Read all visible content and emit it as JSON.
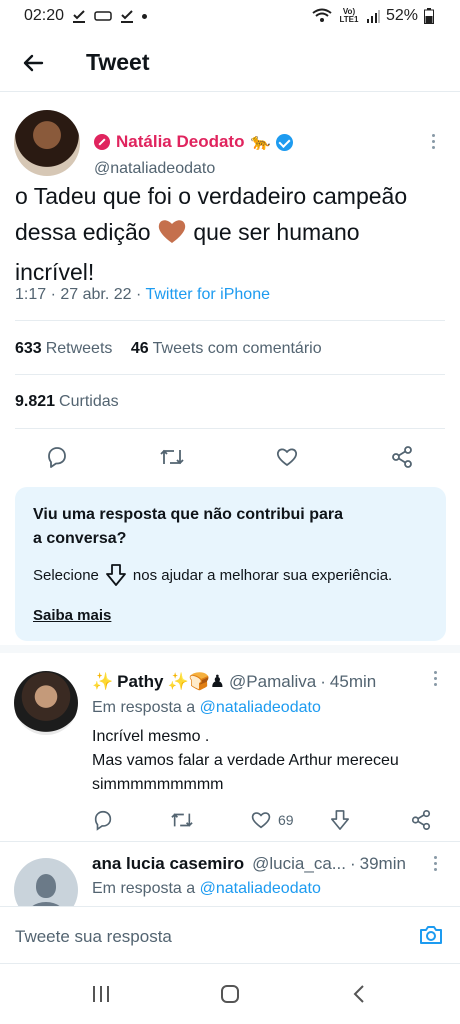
{
  "status_bar": {
    "time": "02:20",
    "network": "Vo) LTE1",
    "battery": "52%"
  },
  "header": {
    "title": "Tweet"
  },
  "tweet": {
    "author_name": "Natália Deodato",
    "author_emoji": "🐆",
    "author_handle": "@nataliadeodato",
    "text_part1": "o Tadeu que foi o verdadeiro campeão dessa edição",
    "text_emoji": "🤎",
    "text_part2": "que ser humano incrível!",
    "time": "1:17",
    "date": "27 abr. 22",
    "separator": "·",
    "source": "Twitter for iPhone",
    "retweets_count": "633",
    "retweets_label": "Retweets",
    "comments_count": "46",
    "comments_label": "Tweets com comentário",
    "likes_count": "9.821",
    "likes_label": "Curtidas"
  },
  "notice": {
    "title": "Viu uma resposta que não contribui para a conversa?",
    "body_prefix": "Selecione",
    "body_suffix": "nos ajudar a melhorar sua experiência.",
    "link": "Saiba mais"
  },
  "replies": [
    {
      "name_prefix_emoji": "✨",
      "name": "Pathy",
      "name_suffix_emoji": "✨🍞♟",
      "handle": "@Pamaliva",
      "time": "45min",
      "reply_to_label": "Em resposta a",
      "reply_to": "@nataliadeodato",
      "text_line1": "Incrível mesmo .",
      "text_line2": "Mas vamos falar a verdade Arthur mereceu simmmmmmmmm",
      "likes": "69"
    },
    {
      "name": "ana lucia casemiro",
      "handle": "@lucia_ca...",
      "time": "39min",
      "reply_to_label": "Em resposta a",
      "reply_to": "@nataliadeodato"
    }
  ],
  "composer": {
    "placeholder": "Tweete sua resposta"
  },
  "icons": {
    "accent": "#1d9bf0",
    "name_color": "#e0245e"
  }
}
